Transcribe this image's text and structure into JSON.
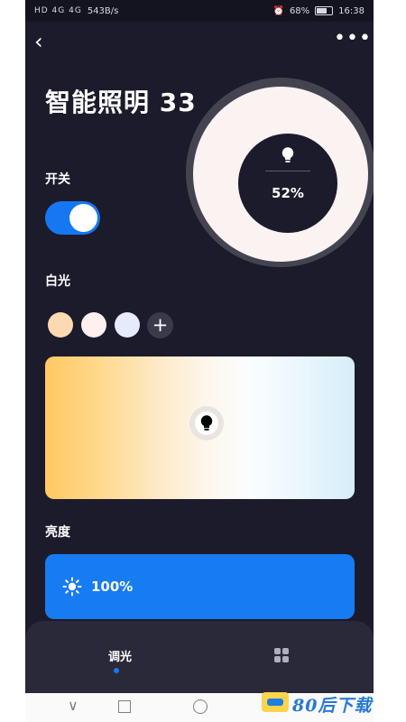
{
  "status_bar": {
    "left_info": "HD 4G 4G",
    "speed": "543B/s",
    "battery": "68%",
    "time": "16:38"
  },
  "header": {
    "back_icon": "back-arrow-icon",
    "more_icon": "more-icon",
    "title": "智能照明 33"
  },
  "dial": {
    "icon": "bulb-icon",
    "value": "52%"
  },
  "switch": {
    "label": "开关",
    "state": "on",
    "accent": "#1677f2"
  },
  "white_light": {
    "label": "白光",
    "swatches": [
      "#fcd9b1",
      "#fdf0ef",
      "#e6eafb"
    ],
    "add_label": "+"
  },
  "brightness": {
    "label": "亮度",
    "value": "100%",
    "icon": "sun-icon"
  },
  "bottom_nav": {
    "tabs": [
      {
        "label": "调光",
        "active": true
      },
      {
        "icon": "grid-icon",
        "active": false
      }
    ]
  },
  "watermark": {
    "text": "80后下载"
  }
}
